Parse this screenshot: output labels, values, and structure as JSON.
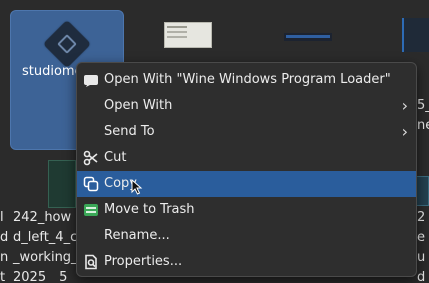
{
  "desktop": {
    "selected_icon_label": "studiome",
    "file_labels": [
      {
        "text": "l\nd\nn\nt"
      },
      {
        "text": "242_how\nd_left_4_c\n_working_\n2025__5"
      },
      {
        "text": "2\ne\nu\nd"
      },
      {
        "text": "5_2\nneth\n"
      }
    ]
  },
  "context_menu": {
    "items": [
      {
        "label": "Open With \"Wine Windows Program Loader\"",
        "icon": "wine-icon",
        "submenu": false
      },
      {
        "label": "Open With",
        "icon": "",
        "submenu": true
      },
      {
        "label": "Send To",
        "icon": "",
        "submenu": true
      },
      {
        "label": "Cut",
        "icon": "scissors-icon",
        "submenu": false
      },
      {
        "label": "Copy",
        "icon": "copy-icon",
        "submenu": false,
        "active": true
      },
      {
        "label": "Move to Trash",
        "icon": "trash-icon",
        "submenu": false
      },
      {
        "label": "Rename...",
        "icon": "",
        "submenu": false
      },
      {
        "label": "Properties...",
        "icon": "properties-icon",
        "submenu": false
      }
    ],
    "submenu_arrow": "›",
    "highlight_color": "#2a5d9c"
  }
}
